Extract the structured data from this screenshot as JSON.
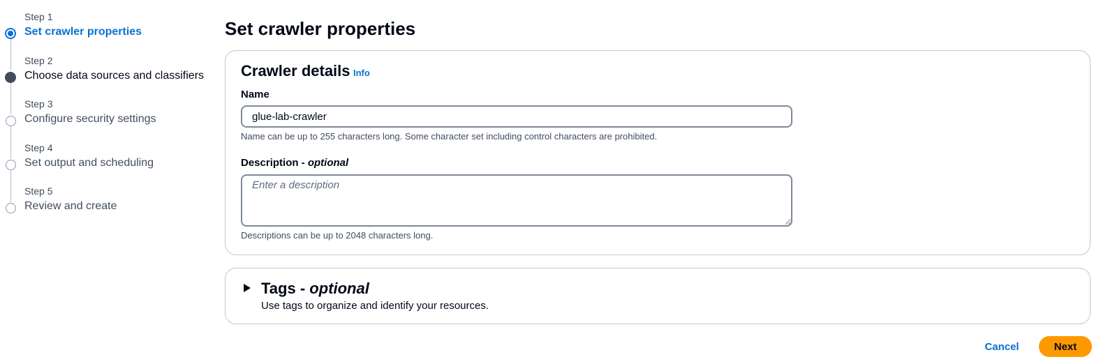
{
  "steps": [
    {
      "number": "Step 1",
      "title": "Set crawler properties",
      "state": "active"
    },
    {
      "number": "Step 2",
      "title": "Choose data sources and classifiers",
      "state": "done"
    },
    {
      "number": "Step 3",
      "title": "Configure security settings",
      "state": "todo"
    },
    {
      "number": "Step 4",
      "title": "Set output and scheduling",
      "state": "todo"
    },
    {
      "number": "Step 5",
      "title": "Review and create",
      "state": "todo"
    }
  ],
  "page": {
    "title": "Set crawler properties"
  },
  "crawler_details": {
    "heading": "Crawler details",
    "info_link": "Info",
    "name": {
      "label": "Name",
      "value": "glue-lab-crawler",
      "hint": "Name can be up to 255 characters long. Some character set including control characters are prohibited."
    },
    "description": {
      "label": "Description - ",
      "label_optional": "optional",
      "placeholder": "Enter a description",
      "hint": "Descriptions can be up to 2048 characters long."
    }
  },
  "tags": {
    "heading": "Tags - ",
    "heading_optional": "optional",
    "description": "Use tags to organize and identify your resources."
  },
  "actions": {
    "cancel_label": "Cancel",
    "next_label": "Next"
  },
  "colors": {
    "accent": "#0972d3",
    "primary_button": "#ff9900",
    "text": "#000716",
    "border": "#c6c6cd"
  }
}
